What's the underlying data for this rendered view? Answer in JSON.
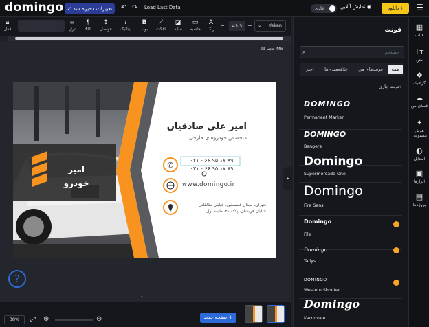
{
  "topbar": {
    "logo": "domingo",
    "save_label": "تغییرات ذخیره شد",
    "load_last": "Load Last Data",
    "toggle_label": "عادی",
    "preview_label": "نمایش آنلاین",
    "download_label": "دانلود"
  },
  "toolbar": {
    "lock_label": "قفل",
    "align_label": "تراز",
    "rtl_label": "RTL",
    "spacing_label": "فواصل",
    "italic_label": "ایتالیک",
    "bold_label": "بولد",
    "effect_label": "افکت",
    "shadow_label": "سایه",
    "stroke_label": "حاشیه",
    "color_label": "رنگ",
    "font_size": "43.3",
    "font_family": "Yekan"
  },
  "canvas": {
    "volume_label": "حجم MB"
  },
  "card": {
    "name": "امیر علی صادقیان",
    "title": "متخصص خودروهای خارجی",
    "phone1": "۰۲۱ - ۶۶ ۹۵ ۱۷ ۸۹",
    "phone2": "۰۲۱ - ۶۶ ۹۵ ۱۷ ۸۹",
    "website": "www.domingo.ir",
    "address_line1": "تهران، میدان فلسطین، خیابان طالقانی،",
    "address_line2": "خیابان قریشان، پلاک ۳۰، طبقه اول",
    "brand_line1": "امیر",
    "brand_line2": "خودرو",
    "colors": {
      "accent": "#f7931e",
      "dark": "#2b2b2b"
    }
  },
  "bottombar": {
    "zoom": "38%",
    "new_page_label": "صفحه جدید +"
  },
  "font_panel": {
    "title": "فونت",
    "search_placeholder": "جستجو",
    "tabs": [
      "همه",
      "فونت‌های من",
      "علاقه‌مندی‌ها",
      "اخیر"
    ],
    "current_font_label": "فونت جاری:",
    "fonts": [
      {
        "sample": "DOMINGO",
        "name": "Permanent Marker",
        "pro": false
      },
      {
        "sample": "DOMINGO",
        "name": "Bangers",
        "pro": false
      },
      {
        "sample": "Domingo",
        "name": "Supermercado One",
        "pro": false
      },
      {
        "sample": "Domingo",
        "name": "Fira Sans",
        "pro": false
      },
      {
        "sample": "Domingo",
        "name": "File",
        "pro": true
      },
      {
        "sample": "Domingo",
        "name": "Tallys",
        "pro": true
      },
      {
        "sample": "DOMINGO",
        "name": "Western Shooter",
        "pro": true
      },
      {
        "sample": "Domingo",
        "name": "Karnovale",
        "pro": false
      }
    ]
  },
  "sidenav": {
    "items": [
      "قالب",
      "متن",
      "گرافیک",
      "فضای من",
      "هوش مصنوعی",
      "استایل",
      "ابزارها",
      "پروژه‌ها"
    ]
  }
}
